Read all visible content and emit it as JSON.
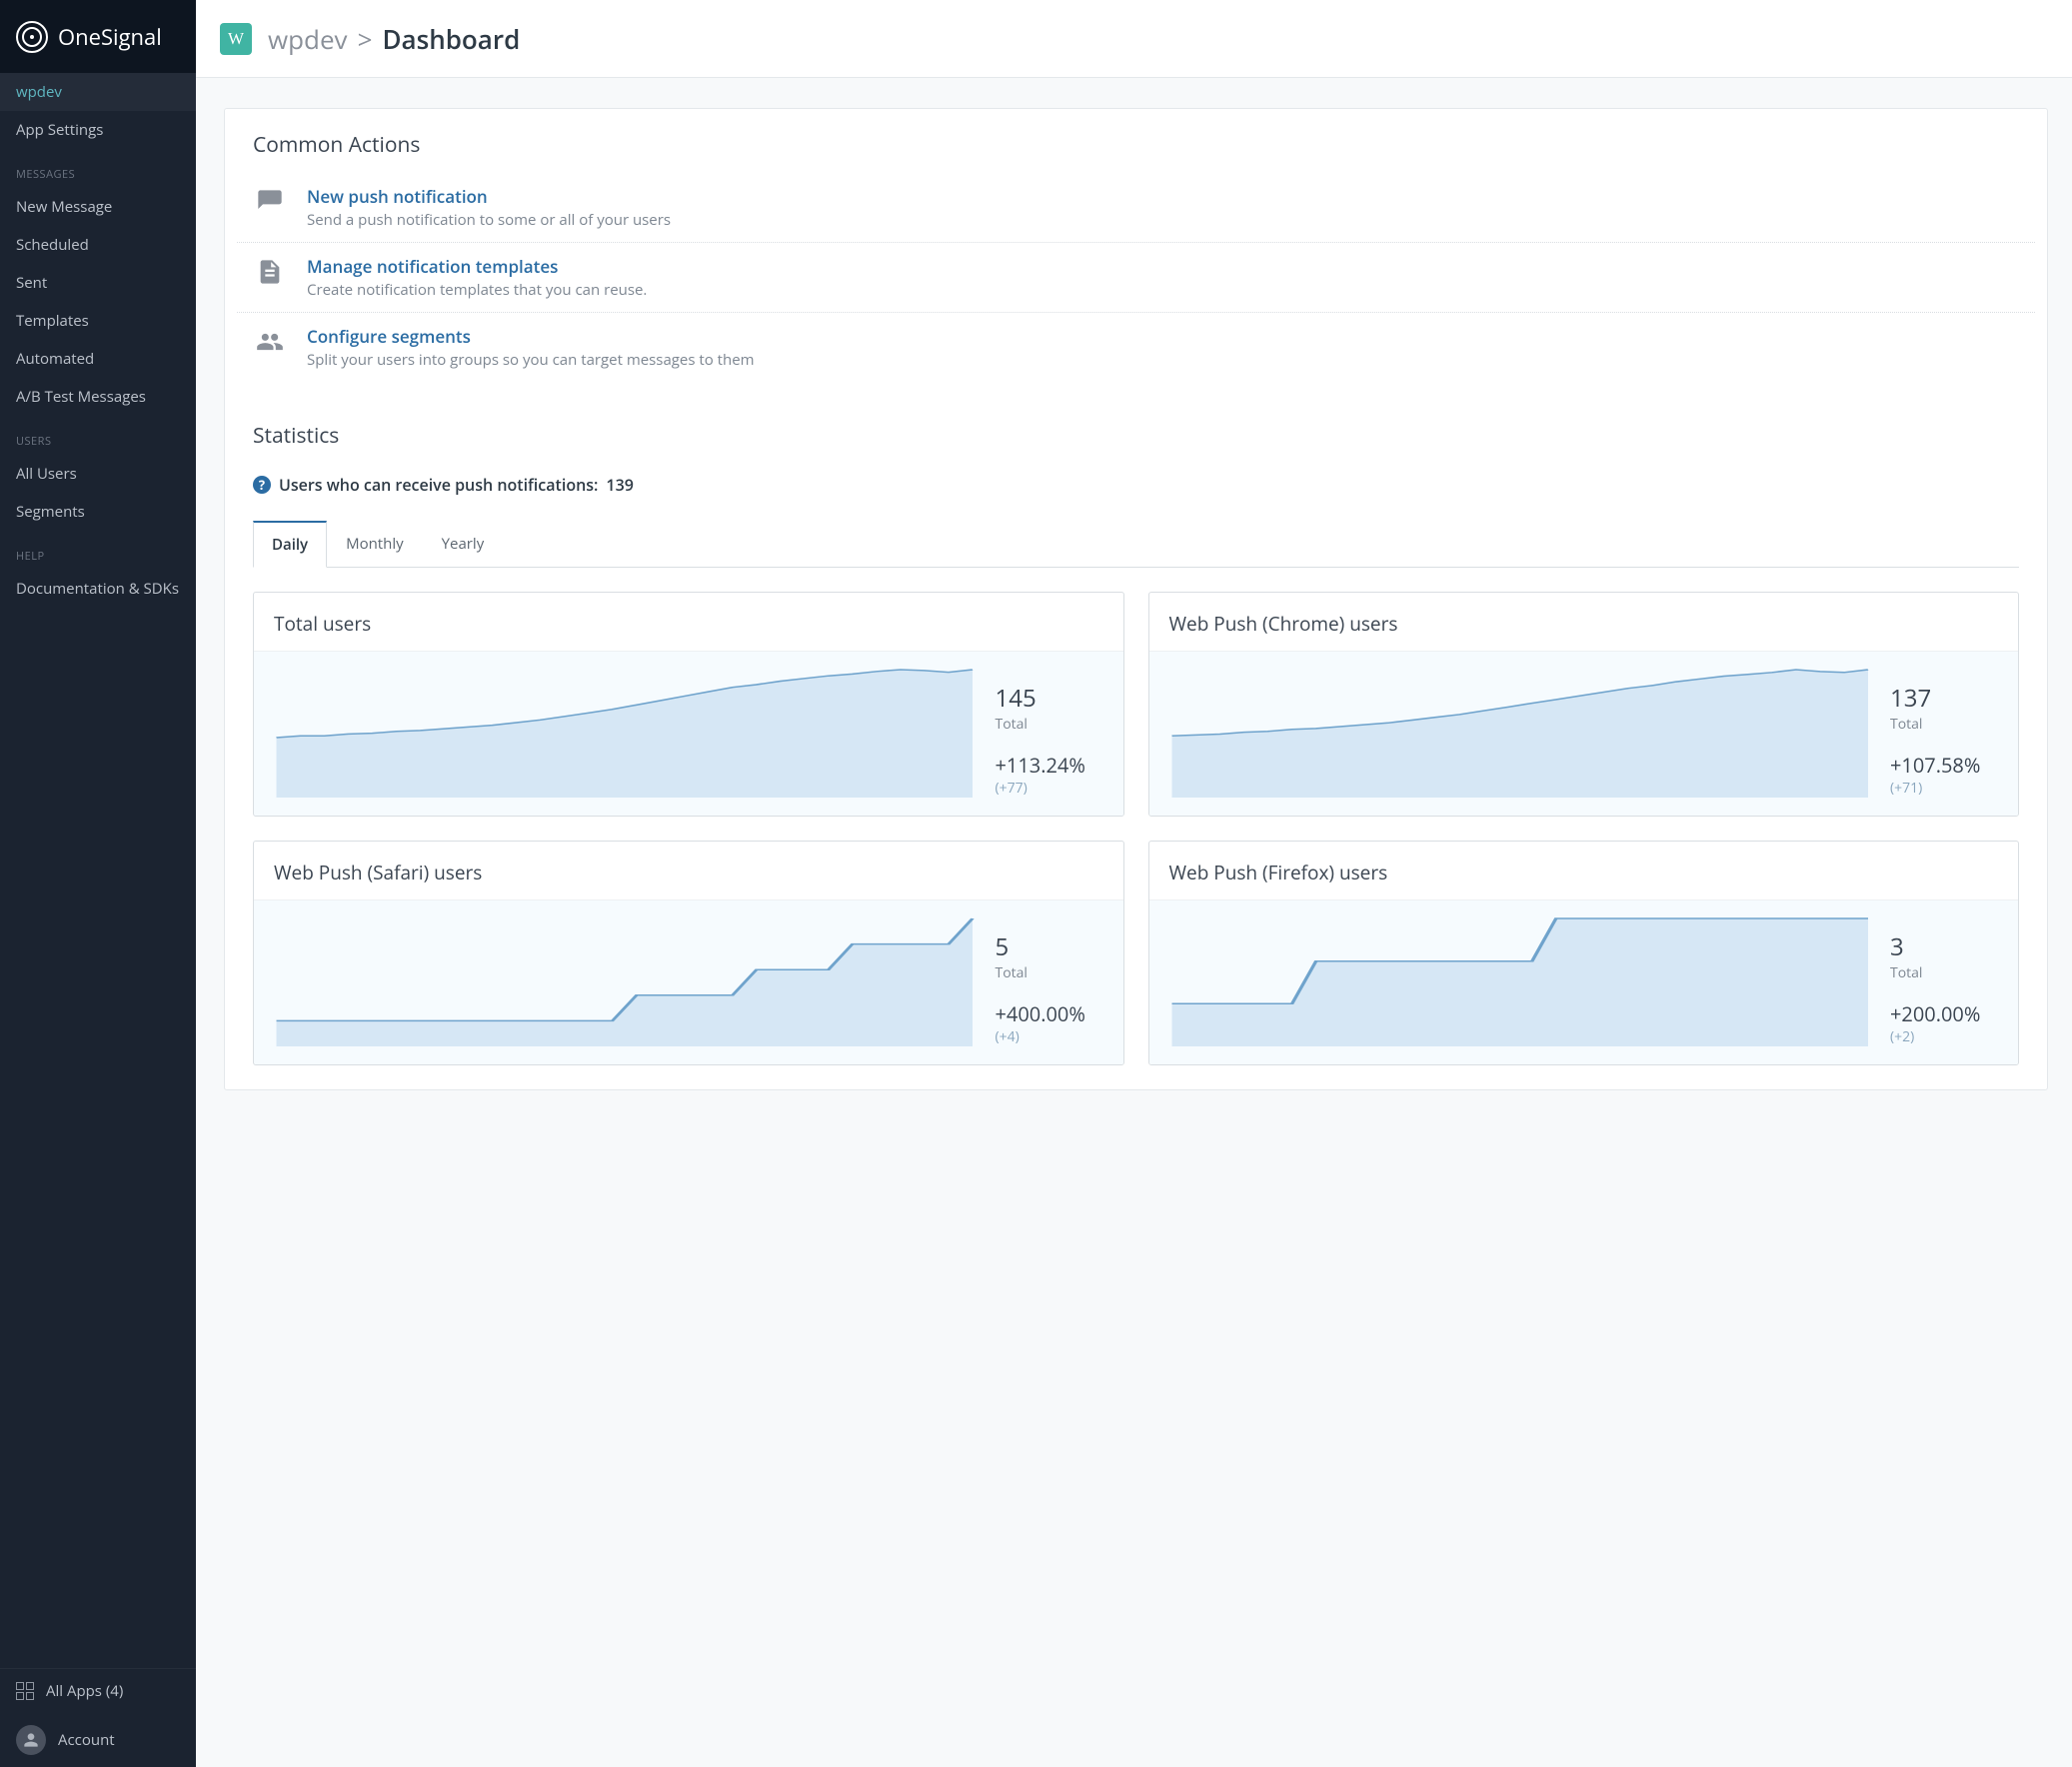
{
  "brand": "OneSignal",
  "sidebar": {
    "top": [
      {
        "label": "wpdev",
        "active": true
      },
      {
        "label": "App Settings"
      }
    ],
    "groups": [
      {
        "label": "MESSAGES",
        "items": [
          {
            "label": "New Message"
          },
          {
            "label": "Scheduled"
          },
          {
            "label": "Sent"
          },
          {
            "label": "Templates"
          },
          {
            "label": "Automated"
          },
          {
            "label": "A/B Test Messages"
          }
        ]
      },
      {
        "label": "USERS",
        "items": [
          {
            "label": "All Users"
          },
          {
            "label": "Segments"
          }
        ]
      },
      {
        "label": "HELP",
        "items": [
          {
            "label": "Documentation & SDKs"
          }
        ]
      }
    ],
    "footer": {
      "all_apps": "All Apps (4)",
      "account": "Account"
    }
  },
  "breadcrumb": {
    "badge": "W",
    "app": "wpdev",
    "sep": ">",
    "page": "Dashboard"
  },
  "common_actions": {
    "title": "Common Actions",
    "items": [
      {
        "title": "New push notification",
        "desc": "Send a push notification to some or all of your users",
        "icon": "comment"
      },
      {
        "title": "Manage notification templates",
        "desc": "Create notification templates that you can reuse.",
        "icon": "file"
      },
      {
        "title": "Configure segments",
        "desc": "Split your users into groups so you can target messages to them",
        "icon": "users"
      }
    ]
  },
  "statistics": {
    "title": "Statistics",
    "push_label": "Users who can receive push notifications:",
    "push_count": "139",
    "tabs": [
      "Daily",
      "Monthly",
      "Yearly"
    ],
    "active_tab": "Daily",
    "cards": [
      {
        "title": "Total users",
        "value": "145",
        "total_label": "Total",
        "pct": "+113.24%",
        "delta": "(+77)"
      },
      {
        "title": "Web Push (Chrome) users",
        "value": "137",
        "total_label": "Total",
        "pct": "+107.58%",
        "delta": "(+71)"
      },
      {
        "title": "Web Push (Safari) users",
        "value": "5",
        "total_label": "Total",
        "pct": "+400.00%",
        "delta": "(+4)"
      },
      {
        "title": "Web Push (Firefox) users",
        "value": "3",
        "total_label": "Total",
        "pct": "+200.00%",
        "delta": "(+2)"
      }
    ]
  },
  "chart_data": [
    {
      "type": "area",
      "title": "Total users",
      "ylim": [
        0,
        145
      ],
      "values": [
        68,
        70,
        70,
        72,
        73,
        75,
        76,
        78,
        80,
        82,
        85,
        88,
        92,
        96,
        100,
        105,
        110,
        115,
        120,
        125,
        128,
        132,
        135,
        138,
        140,
        143,
        145,
        144,
        142,
        145
      ]
    },
    {
      "type": "area",
      "title": "Web Push (Chrome) users",
      "ylim": [
        0,
        137
      ],
      "values": [
        66,
        67,
        68,
        70,
        71,
        73,
        74,
        76,
        78,
        80,
        83,
        86,
        89,
        93,
        97,
        101,
        105,
        109,
        113,
        117,
        120,
        124,
        127,
        130,
        132,
        134,
        137,
        135,
        134,
        137
      ]
    },
    {
      "type": "area",
      "title": "Web Push (Safari) users",
      "ylim": [
        0,
        5
      ],
      "values": [
        1,
        1,
        1,
        1,
        1,
        1,
        1,
        1,
        1,
        1,
        1,
        1,
        1,
        1,
        1,
        2,
        2,
        2,
        2,
        2,
        3,
        3,
        3,
        3,
        4,
        4,
        4,
        4,
        4,
        5
      ]
    },
    {
      "type": "area",
      "title": "Web Push (Firefox) users",
      "ylim": [
        0,
        3
      ],
      "values": [
        1,
        1,
        1,
        1,
        1,
        1,
        2,
        2,
        2,
        2,
        2,
        2,
        2,
        2,
        2,
        2,
        3,
        3,
        3,
        3,
        3,
        3,
        3,
        3,
        3,
        3,
        3,
        3,
        3,
        3
      ]
    }
  ]
}
